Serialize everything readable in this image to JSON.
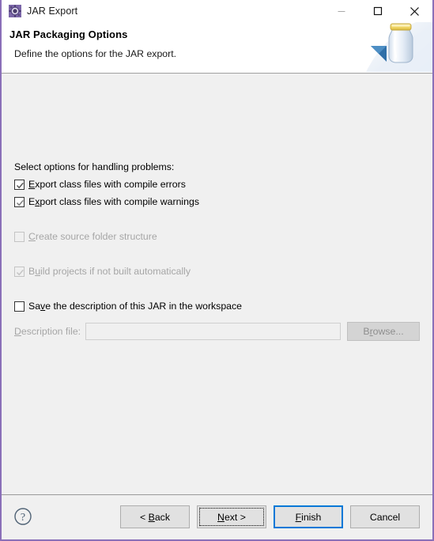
{
  "window": {
    "title": "JAR Export",
    "icon": "jar-export-icon",
    "border_color": "#8a6fb8",
    "controls": [
      {
        "name": "minimize",
        "glyph": "minimize-icon"
      },
      {
        "name": "maximize",
        "glyph": "maximize-icon"
      },
      {
        "name": "close",
        "glyph": "close-icon"
      }
    ]
  },
  "header": {
    "title": "JAR Packaging Options",
    "description": "Define the options for the JAR export.",
    "banner_icon": "jar-bottle-banner-icon"
  },
  "content": {
    "section_label": "Select options for handling problems:",
    "options": [
      {
        "id": "export-compile-errors",
        "label_pre": "",
        "mnemonic": "E",
        "label_post": "xport class files with compile errors",
        "checked": true,
        "enabled": true
      },
      {
        "id": "export-compile-warnings",
        "label_pre": "E",
        "mnemonic": "x",
        "label_post": "port class files with compile warnings",
        "checked": true,
        "enabled": true
      },
      {
        "id": "create-source-folder-structure",
        "label_pre": "",
        "mnemonic": "C",
        "label_post": "reate source folder structure",
        "checked": false,
        "enabled": false
      },
      {
        "id": "build-projects-if-not-built",
        "label_pre": "B",
        "mnemonic": "u",
        "label_post": "ild projects if not built automatically",
        "checked": true,
        "enabled": false
      },
      {
        "id": "save-description-in-workspace",
        "label_pre": "Sa",
        "mnemonic": "v",
        "label_post": "e the description of this JAR in the workspace",
        "checked": false,
        "enabled": true
      }
    ],
    "description_file": {
      "label_pre": "",
      "label_mnemonic": "D",
      "label_post": "escription file:",
      "value": "",
      "placeholder": "",
      "enabled": false,
      "browse": {
        "label_pre": "B",
        "mnemonic": "r",
        "label_post": "owse...",
        "enabled": false
      }
    }
  },
  "footer": {
    "help_icon": "help-question-icon",
    "buttons": [
      {
        "id": "back",
        "label_pre": "< ",
        "mnemonic": "B",
        "label_post": "ack",
        "state": "normal"
      },
      {
        "id": "next",
        "label_pre": "",
        "mnemonic": "N",
        "label_post": "ext >",
        "state": "focused"
      },
      {
        "id": "finish",
        "label_pre": "",
        "mnemonic": "F",
        "label_post": "inish",
        "state": "default"
      },
      {
        "id": "cancel",
        "label_pre": "Cancel",
        "mnemonic": "",
        "label_post": "",
        "state": "normal"
      }
    ]
  },
  "colors": {
    "accent_blue": "#0078d7",
    "window_border": "#8a6fb8",
    "dialog_bg": "#f0f0f0",
    "header_bg": "#ffffff",
    "disabled_text": "#a6a6a6"
  }
}
